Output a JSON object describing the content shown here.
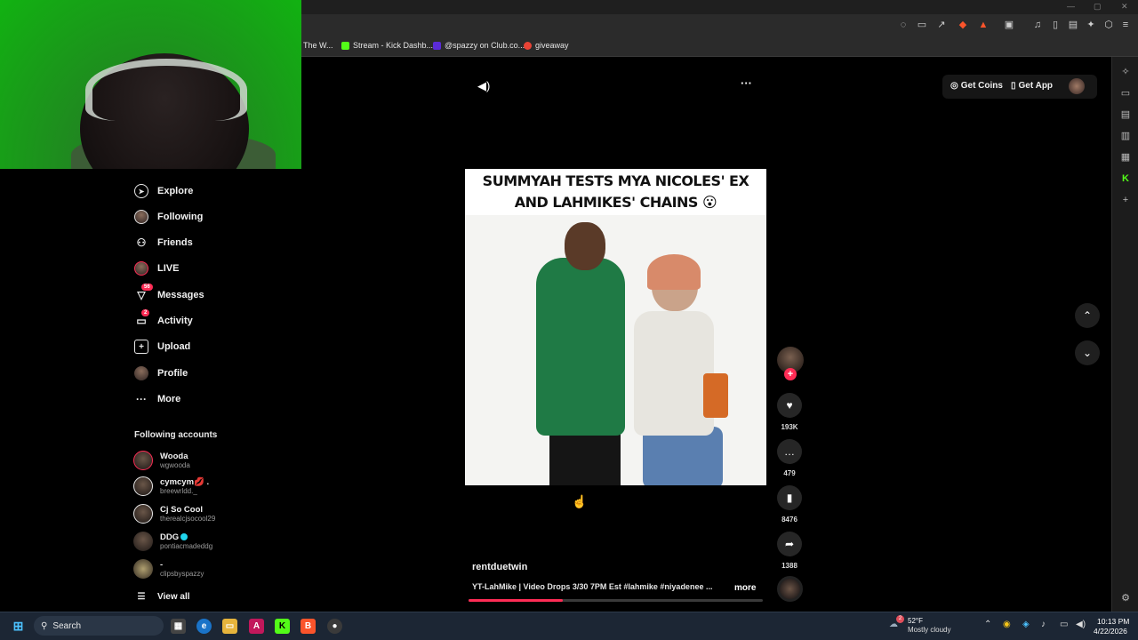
{
  "browser": {
    "bookmarks": [
      {
        "label": "The W...",
        "color": "#444444"
      },
      {
        "label": "Stream - Kick Dashb...",
        "color": "#53fc18"
      },
      {
        "label": "@spazzy on Club.co...",
        "color": "#5b2bd8"
      },
      {
        "label": "giveaway",
        "color": "#ea4335"
      }
    ]
  },
  "nav": {
    "items": [
      {
        "label": "Explore",
        "icon": "compass-icon"
      },
      {
        "label": "Following",
        "icon": "following-icon"
      },
      {
        "label": "Friends",
        "icon": "friends-icon"
      },
      {
        "label": "LIVE",
        "icon": "live-icon"
      },
      {
        "label": "Messages",
        "icon": "messages-icon",
        "badge": "56"
      },
      {
        "label": "Activity",
        "icon": "activity-icon",
        "badge": "2"
      },
      {
        "label": "Upload",
        "icon": "upload-icon"
      },
      {
        "label": "Profile",
        "icon": "profile-icon"
      },
      {
        "label": "More",
        "icon": "more-icon"
      }
    ],
    "following_heading": "Following accounts",
    "accounts": [
      {
        "name": "Wooda",
        "handle": "wgwooda"
      },
      {
        "name": "cymcym💋 .",
        "handle": "breewrldd._"
      },
      {
        "name": "Cj So Cool",
        "handle": "therealcjsocool29"
      },
      {
        "name": "DDG",
        "handle": "pontiacmadeddg",
        "verified": true
      },
      {
        "name": "-",
        "handle": "clipsbyspazzy"
      }
    ],
    "view_all": "View all"
  },
  "header": {
    "get_coins": "Get Coins",
    "get_app": "Get App"
  },
  "video": {
    "title": "SUMMYAH TESTS MYA NICOLES' EX AND LAHMIKES' CHAINS 😮",
    "username": "rentduetwin",
    "caption": "YT-LahMike | Video Drops 3/30 7PM Est #lahmike #niyadenee ...",
    "more": "more",
    "progress": 0.32
  },
  "actions": {
    "likes": "193K",
    "comments": "479",
    "saves": "8476",
    "shares": "1388"
  },
  "taskbar": {
    "search": "Search",
    "weather_temp": "52°F",
    "weather_desc": "Mostly cloudy",
    "time": "10:13 PM",
    "date": "4/22/2026",
    "weather_badge": "2"
  }
}
